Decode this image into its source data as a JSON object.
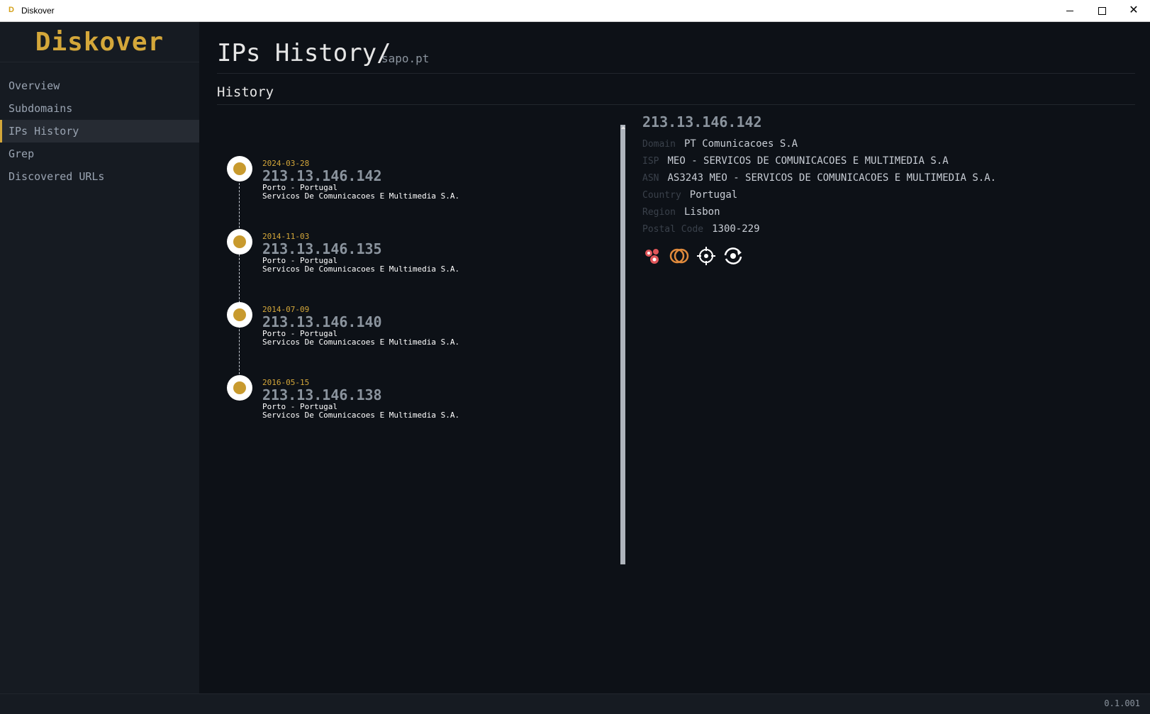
{
  "window": {
    "title": "Diskover"
  },
  "sidebar": {
    "logo": "Diskover",
    "items": [
      {
        "label": "Overview"
      },
      {
        "label": "Subdomains"
      },
      {
        "label": "IPs History"
      },
      {
        "label": "Grep"
      },
      {
        "label": "Discovered URLs"
      }
    ],
    "active_index": 2
  },
  "page": {
    "title": "IPs History/",
    "domain": "sapo.pt",
    "section": "History"
  },
  "history": [
    {
      "date": "2024-03-28",
      "ip": "213.13.146.142",
      "location": "Porto - Portugal",
      "org": "Servicos De Comunicacoes E Multimedia S.A."
    },
    {
      "date": "2014-11-03",
      "ip": "213.13.146.135",
      "location": "Porto - Portugal",
      "org": "Servicos De Comunicacoes E Multimedia S.A."
    },
    {
      "date": "2014-07-09",
      "ip": "213.13.146.140",
      "location": "Porto - Portugal",
      "org": "Servicos De Comunicacoes E Multimedia S.A."
    },
    {
      "date": "2016-05-15",
      "ip": "213.13.146.138",
      "location": "Porto - Portugal",
      "org": "Servicos De Comunicacoes E Multimedia S.A."
    }
  ],
  "detail": {
    "ip": "213.13.146.142",
    "fields": [
      {
        "label": "Domain",
        "value": "PT Comunicacoes S.A"
      },
      {
        "label": "ISP",
        "value": "MEO - SERVICOS DE COMUNICACOES E MULTIMEDIA S.A"
      },
      {
        "label": "ASN",
        "value": "AS3243 MEO - SERVICOS DE COMUNICACOES E MULTIMEDIA S.A."
      },
      {
        "label": "Country",
        "value": "Portugal"
      },
      {
        "label": "Region",
        "value": "Lisbon"
      },
      {
        "label": "Postal Code",
        "value": "1300-229"
      }
    ],
    "icons": [
      "red-dots-icon",
      "orange-rings-icon",
      "crosshair-icon",
      "refresh-eye-icon"
    ]
  },
  "status": {
    "version": "0.1.001"
  },
  "colors": {
    "accent": "#d4a73a",
    "background": "#0d1117",
    "sidebar": "#161b22"
  }
}
